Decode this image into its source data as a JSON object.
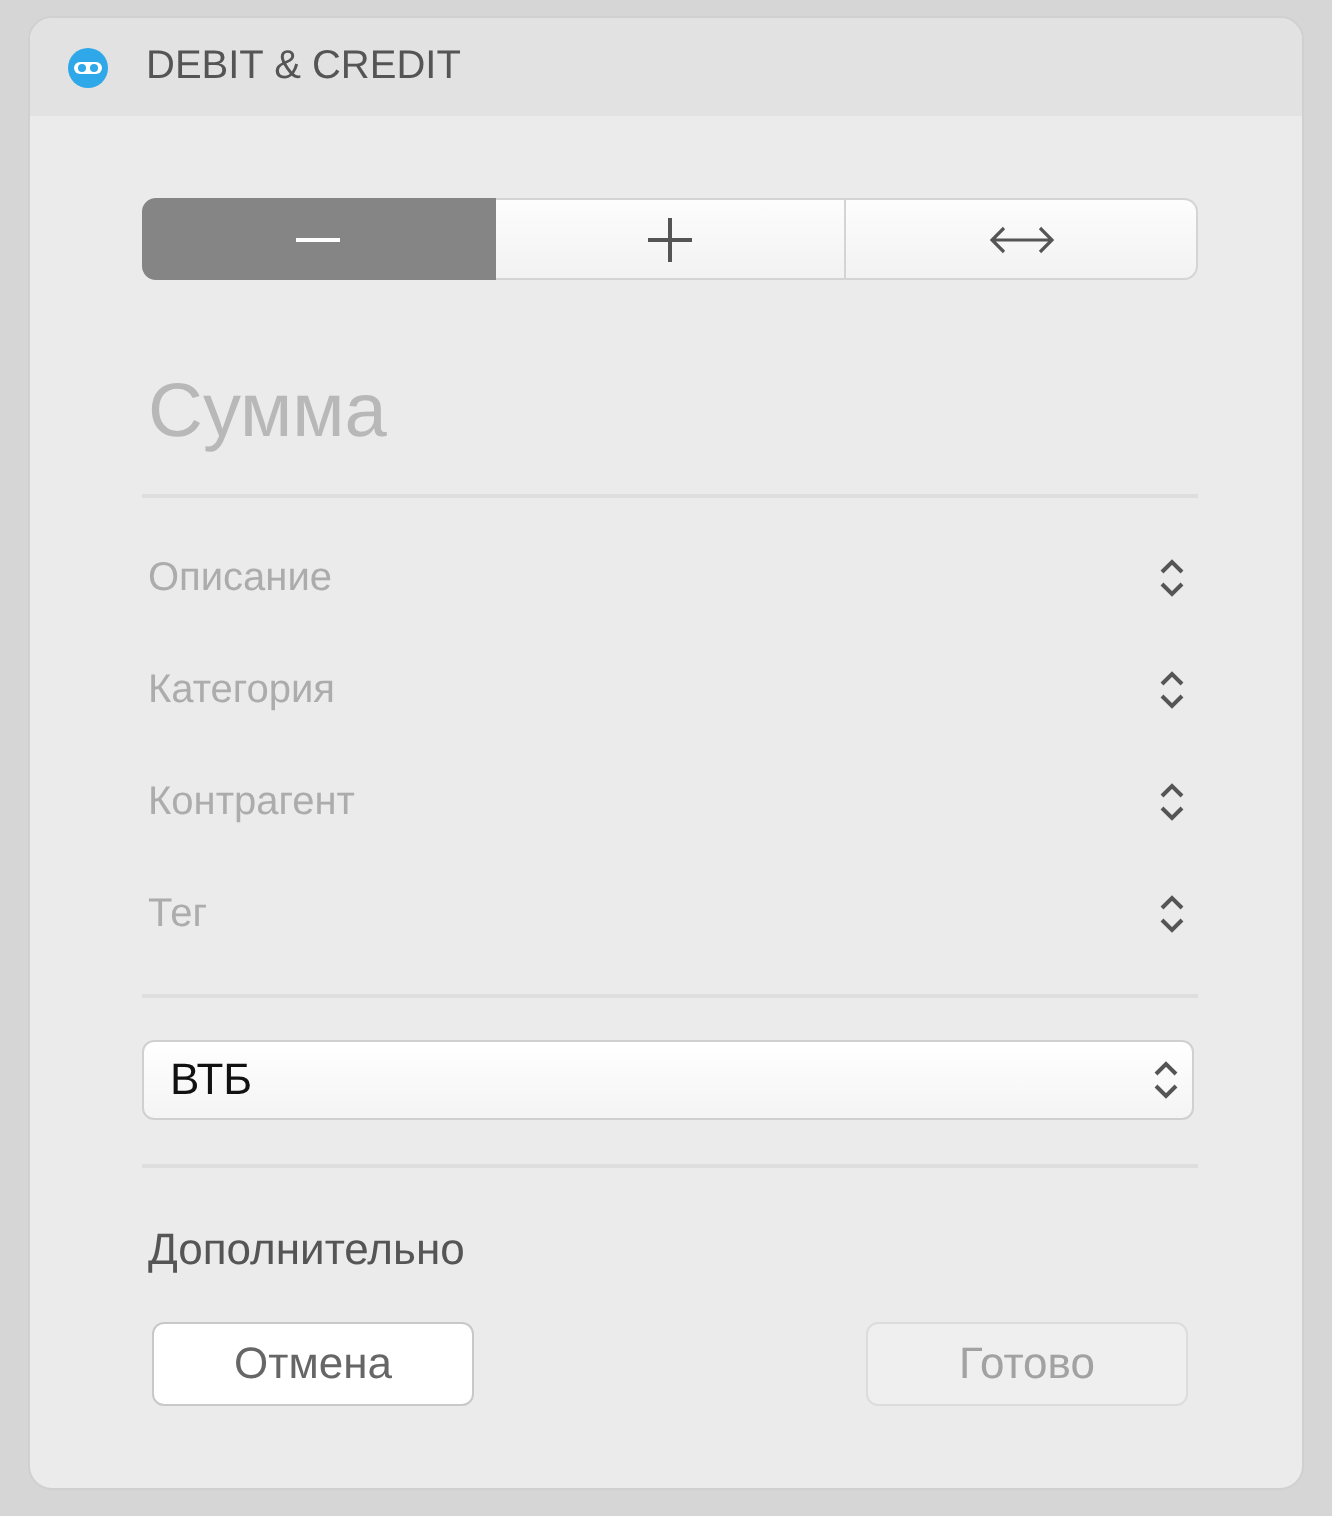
{
  "window": {
    "title": "DEBIT & CREDIT"
  },
  "segments": [
    {
      "kind": "minus",
      "selected": true
    },
    {
      "kind": "plus",
      "selected": false
    },
    {
      "kind": "transfer",
      "selected": false
    }
  ],
  "amount": {
    "placeholder": "Сумма"
  },
  "fields": [
    {
      "placeholder": "Описание"
    },
    {
      "placeholder": "Категория"
    },
    {
      "placeholder": "Контрагент"
    },
    {
      "placeholder": "Тег"
    }
  ],
  "account": {
    "value": "ВТБ"
  },
  "more_label": "Дополнительно",
  "buttons": [
    {
      "label": "Отмена",
      "disabled": false
    },
    {
      "label": "Готово",
      "disabled": true
    }
  ]
}
